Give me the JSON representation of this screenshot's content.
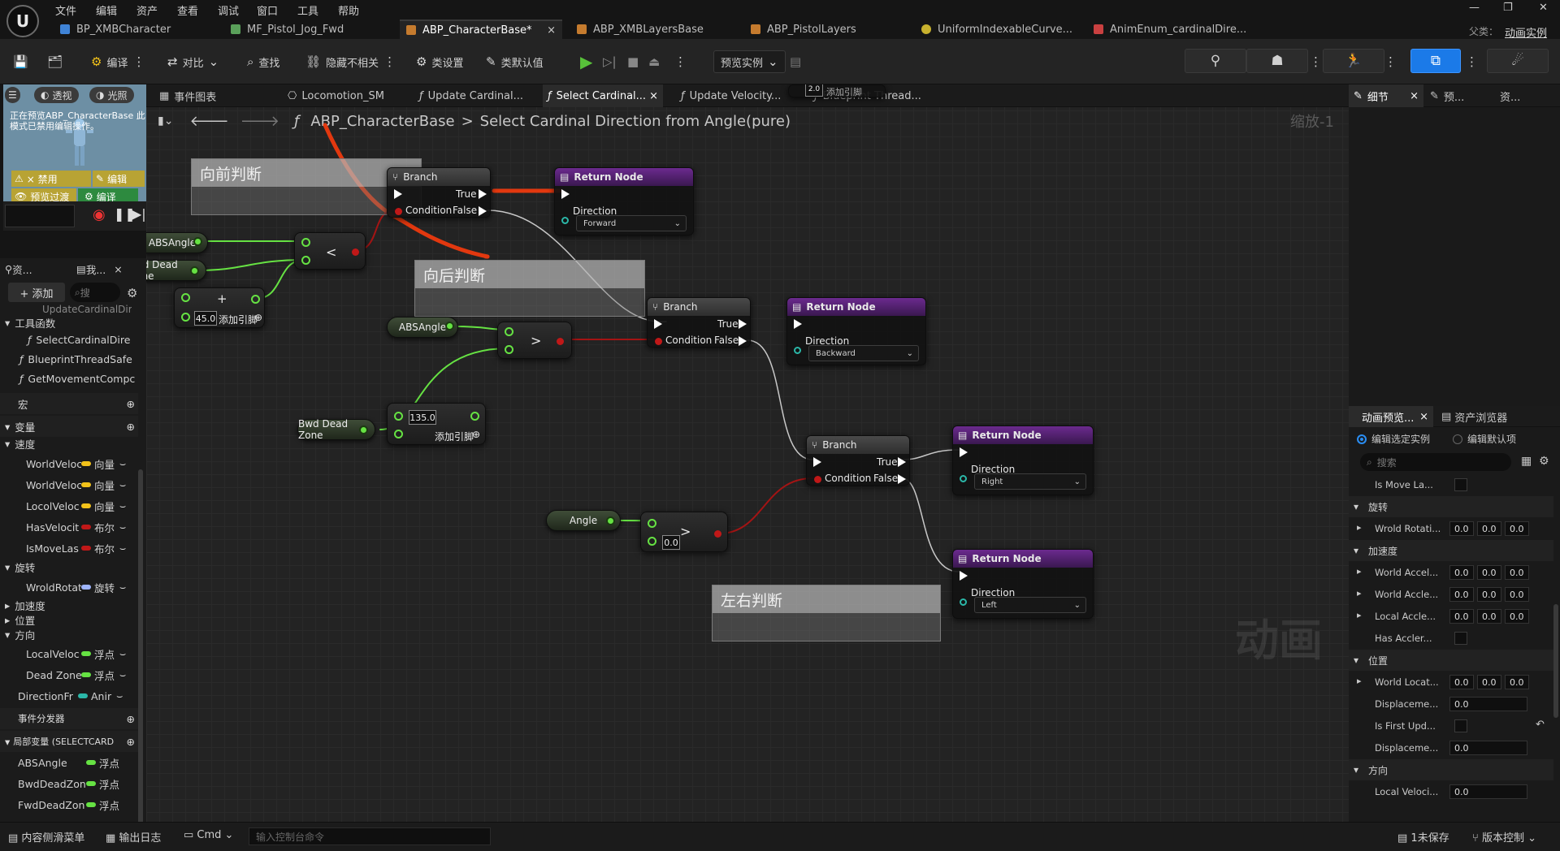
{
  "menu": [
    "文件",
    "编辑",
    "资产",
    "查看",
    "调试",
    "窗口",
    "工具",
    "帮助"
  ],
  "tabs": [
    {
      "label": "BP_XMBCharacter",
      "color": "#3f83d6"
    },
    {
      "label": "MF_Pistol_Jog_Fwd",
      "color": "#5aa05a"
    },
    {
      "label": "ABP_CharacterBase*",
      "color": "#c57b2e",
      "close": "×"
    },
    {
      "label": "ABP_XMBLayersBase",
      "color": "#c57b2e"
    },
    {
      "label": "ABP_PistolLayers",
      "color": "#c57b2e"
    },
    {
      "label": "UniformIndexableCurve...",
      "color": "#c8b12e"
    },
    {
      "label": "AnimEnum_cardinalDire...",
      "color": "#c94040"
    }
  ],
  "parent_class": {
    "label": "父类：",
    "value": "动画实例"
  },
  "toolbar": {
    "compile": "编译",
    "diff": "对比",
    "find": "查找",
    "hide": "隐藏不相关",
    "class_settings": "类设置",
    "class_defaults": "类默认值",
    "preview_instance": "预览实例"
  },
  "preview": {
    "perspective": "透视",
    "lit": "光照",
    "warning": "正在预览ABP_CharacterBase 此模式已禁用编辑操作。",
    "disabled": "× 禁用",
    "edit": "编辑",
    "preview_transition": "预览过渡",
    "compile": "编译"
  },
  "left_panel": {
    "tab1": "资...",
    "tab2": "我...",
    "add": "+ 添加",
    "search_placeholder": "搜",
    "cut_item": "UpdateCardinalDir",
    "sections": {
      "functions": "工具函数",
      "macros": "宏",
      "variables": "变量",
      "dispatchers": "事件分发器",
      "locals": "局部变量 (SELECTCARD"
    },
    "functions": [
      "SelectCardinalDire",
      "BlueprintThreadSafe",
      "GetMovementCompc"
    ],
    "groups": {
      "speed": "速度",
      "rotation": "旋转",
      "accel": "加速度",
      "position": "位置",
      "direction": "方向"
    },
    "speed_vars": [
      {
        "name": "WorldVeloc",
        "type": "向量",
        "color": "#f2c21a"
      },
      {
        "name": "WorldVeloc",
        "type": "向量",
        "color": "#f2c21a"
      },
      {
        "name": "LocolVeloc",
        "type": "向量",
        "color": "#f2c21a"
      },
      {
        "name": "HasVelocit",
        "type": "布尔",
        "color": "#c01818"
      },
      {
        "name": "IsMoveLas",
        "type": "布尔",
        "color": "#c01818"
      }
    ],
    "rot_vars": [
      {
        "name": "WroldRotat",
        "type": "旋转",
        "color": "#9fb5ff"
      }
    ],
    "dir_vars": [
      {
        "name": "LocalVeloc",
        "type": "浮点",
        "color": "#66e243"
      },
      {
        "name": "Dead Zone",
        "type": "浮点",
        "color": "#66e243"
      },
      {
        "name": "DirectionFr",
        "type": "Anir",
        "color": "#2bb7a8"
      }
    ],
    "local_vars": [
      {
        "name": "ABSAngle",
        "type": "浮点",
        "color": "#66e243"
      },
      {
        "name": "BwdDeadZon",
        "type": "浮点",
        "color": "#66e243"
      },
      {
        "name": "FwdDeadZon",
        "type": "浮点",
        "color": "#66e243"
      }
    ]
  },
  "graph_tabs": [
    "事件图表",
    "Locomotion_SM",
    "Update Cardinal...",
    "Select Cardinal...",
    "Update Velocity...",
    "Blueprint Thread..."
  ],
  "breadcrumb": {
    "root": "ABP_CharacterBase",
    "sep": ">",
    "current": "Select Cardinal Direction from Angle(pure)",
    "zoom": "缩放-1"
  },
  "graph": {
    "comments": {
      "fwd": "向前判断",
      "bwd": "向后判断",
      "lr": "左右判断"
    },
    "branch": {
      "title": "Branch",
      "true": "True",
      "false": "False",
      "condition": "Condition"
    },
    "return": {
      "title": "Return Node",
      "direction": "Direction"
    },
    "directions": [
      "Forward",
      "Backward",
      "Right",
      "Left"
    ],
    "vars": {
      "abs": "ABSAngle",
      "fwd": "Fwd Dead Zone",
      "bwd": "Bwd Dead Zone",
      "angle": "Angle"
    },
    "values": {
      "v45": "45.0",
      "v135": "135.0",
      "v0": "0.0",
      "top": "2.0"
    },
    "add_pin": "添加引脚",
    "ops": {
      "lt": "<",
      "gt": ">",
      "plus": "+"
    },
    "watermark": "动画"
  },
  "right_panel": {
    "tab_details": "细节",
    "tab_preview": "预...",
    "tab_res": "资...",
    "tab_anim_preview": "动画预览...",
    "tab_assets": "资产浏览器",
    "radio1": "编辑选定实例",
    "radio2": "编辑默认项",
    "search_placeholder": "搜索",
    "rows": [
      {
        "label": "Is Move La...",
        "kind": "check"
      },
      {
        "label": "旋转",
        "kind": "section"
      },
      {
        "label": "Wrold Rotati...",
        "kind": "vec",
        "vals": [
          "0.0",
          "0.0",
          "0.0"
        ]
      },
      {
        "label": "加速度",
        "kind": "section"
      },
      {
        "label": "World Accel...",
        "kind": "vec",
        "vals": [
          "0.0",
          "0.0",
          "0.0"
        ]
      },
      {
        "label": "World Accle...",
        "kind": "vec",
        "vals": [
          "0.0",
          "0.0",
          "0.0"
        ]
      },
      {
        "label": "Local Accle...",
        "kind": "vec",
        "vals": [
          "0.0",
          "0.0",
          "0.0"
        ]
      },
      {
        "label": "Has Accler...",
        "kind": "check"
      },
      {
        "label": "位置",
        "kind": "section"
      },
      {
        "label": "World Locat...",
        "kind": "vec",
        "vals": [
          "0.0",
          "0.0",
          "0.0"
        ]
      },
      {
        "label": "Displaceme...",
        "kind": "num",
        "vals": [
          "0.0"
        ]
      },
      {
        "label": "Is First Upd...",
        "kind": "check"
      },
      {
        "label": "Displaceme...",
        "kind": "num",
        "vals": [
          "0.0"
        ]
      },
      {
        "label": "方向",
        "kind": "section"
      },
      {
        "label": "Local Veloci...",
        "kind": "num",
        "vals": [
          "0.0"
        ]
      }
    ]
  },
  "status": {
    "content_drawer": "内容侧滑菜单",
    "output_log": "输出日志",
    "cmd": "Cmd",
    "console_placeholder": "输入控制台命令",
    "unsaved": "1未保存",
    "source_control": "版本控制"
  }
}
